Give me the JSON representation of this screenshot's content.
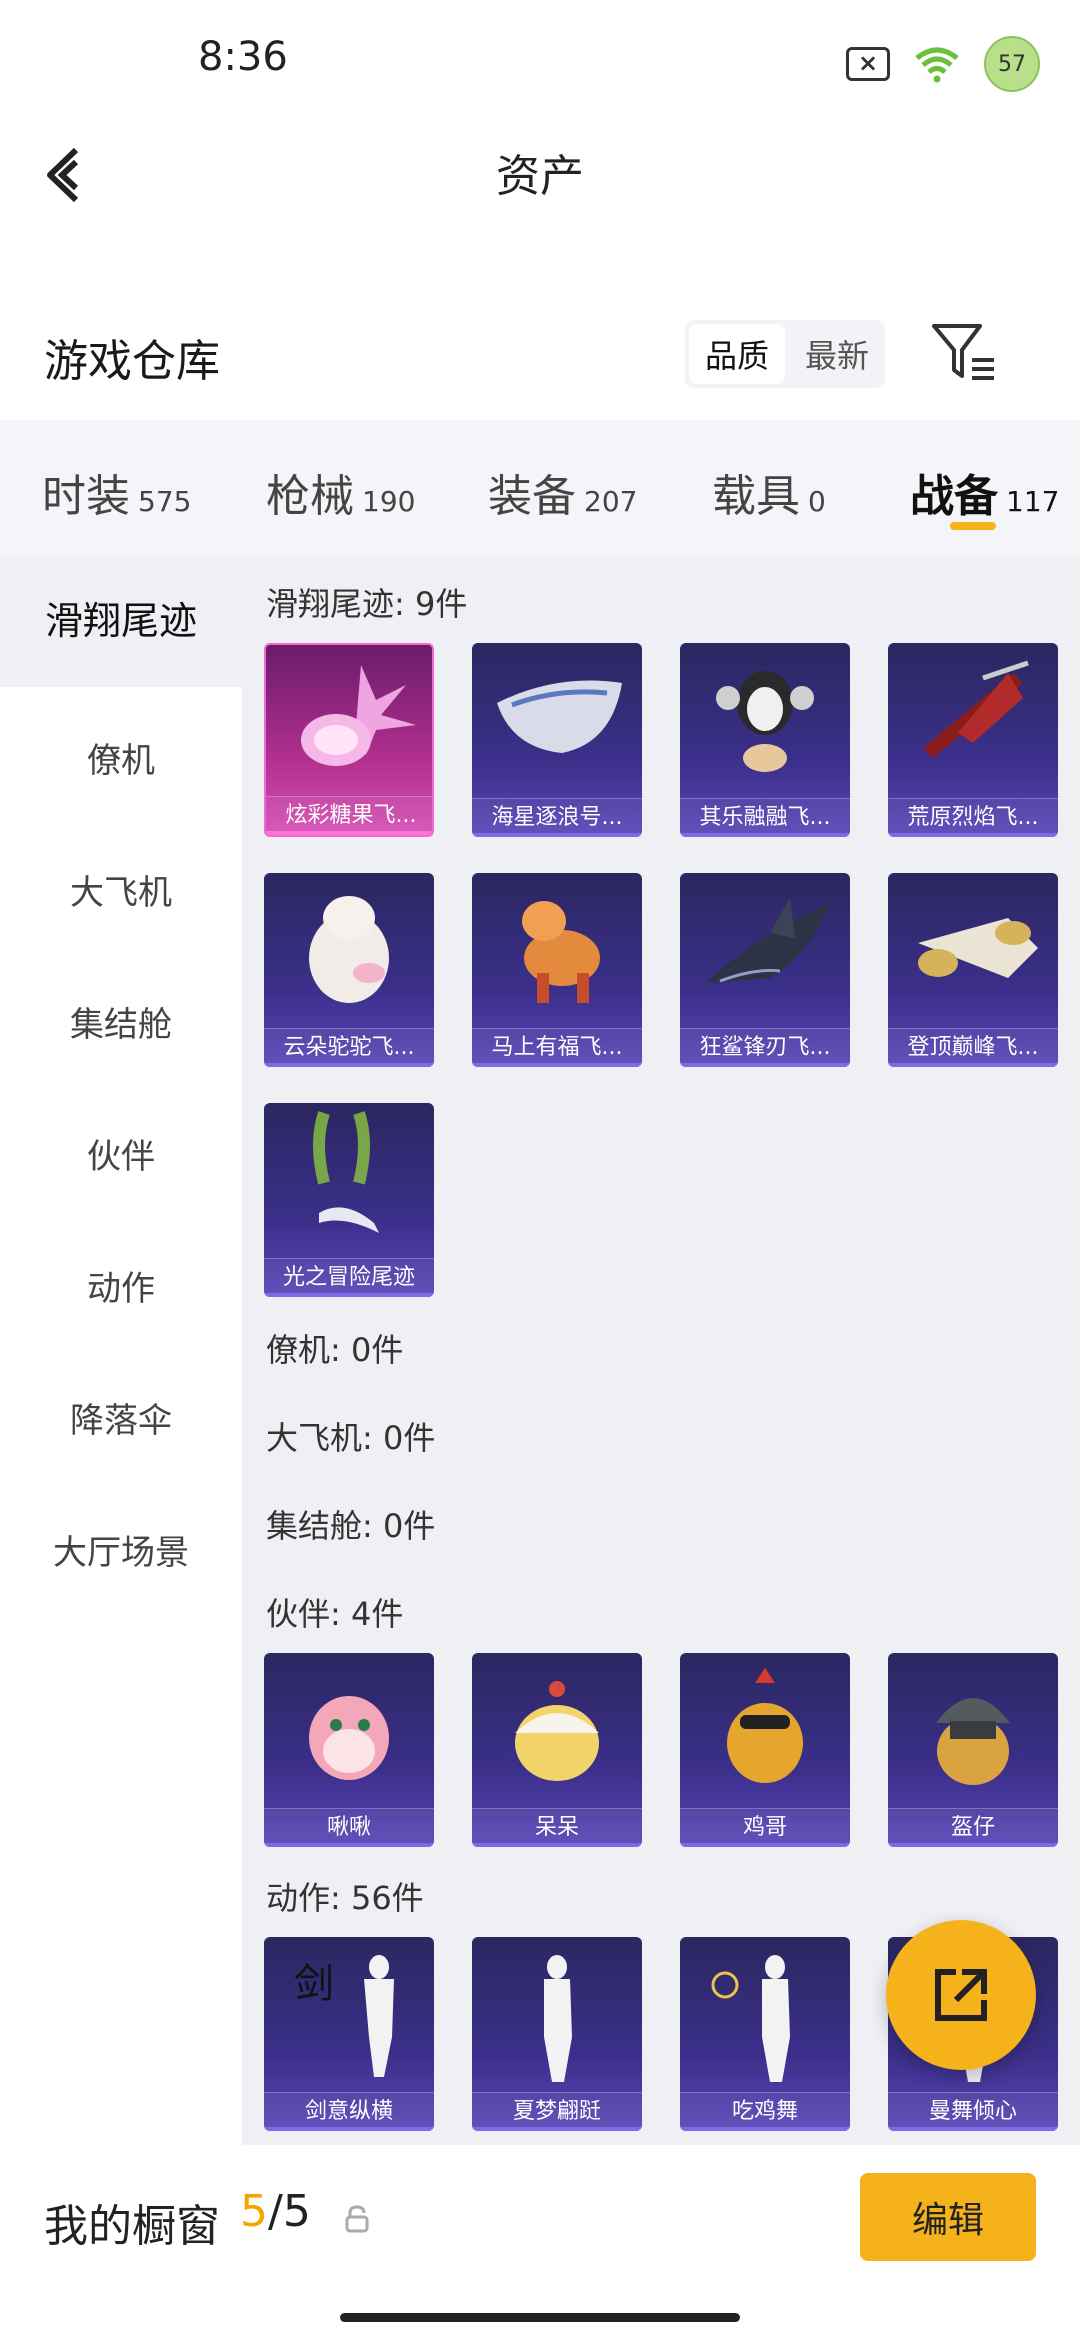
{
  "status": {
    "time": "8:36",
    "battery": "57"
  },
  "header": {
    "title": "资产"
  },
  "warehouse": {
    "title": "游戏仓库",
    "sort_options": [
      "品质",
      "最新"
    ],
    "sort_active": 0
  },
  "tabs": [
    {
      "label": "时装",
      "count": "575"
    },
    {
      "label": "枪械",
      "count": "190"
    },
    {
      "label": "装备",
      "count": "207"
    },
    {
      "label": "载具",
      "count": "0"
    },
    {
      "label": "战备",
      "count": "117"
    }
  ],
  "sidebar": [
    "滑翔尾迹",
    "僚机",
    "大飞机",
    "集结舱",
    "伙伴",
    "动作",
    "降落伞",
    "大厅场景"
  ],
  "sections": {
    "glide": {
      "title": "滑翔尾迹: 9件",
      "items": [
        "炫彩糖果飞...",
        "海星逐浪号...",
        "其乐融融飞...",
        "荒原烈焰飞...",
        "云朵驼驼飞...",
        "马上有福飞...",
        "狂鲨锋刃飞...",
        "登顶巅峰飞...",
        "光之冒险尾迹"
      ]
    },
    "wingman": {
      "title": "僚机: 0件"
    },
    "plane": {
      "title": "大飞机: 0件"
    },
    "pod": {
      "title": "集结舱: 0件"
    },
    "partner": {
      "title": "伙伴: 4件",
      "items": [
        "啾啾",
        "呆呆",
        "鸡哥",
        "盔仔"
      ]
    },
    "emote": {
      "title": "动作: 56件",
      "items": [
        "剑意纵横",
        "夏梦翩跹",
        "吃鸡舞",
        "曼舞倾心"
      ]
    }
  },
  "bottom": {
    "label": "我的橱窗",
    "current": "5",
    "total": "/5",
    "edit": "编辑"
  },
  "colors": {
    "accent": "#f5b21a",
    "card": "#3b2f8a",
    "card_pink": "#b1308f"
  }
}
